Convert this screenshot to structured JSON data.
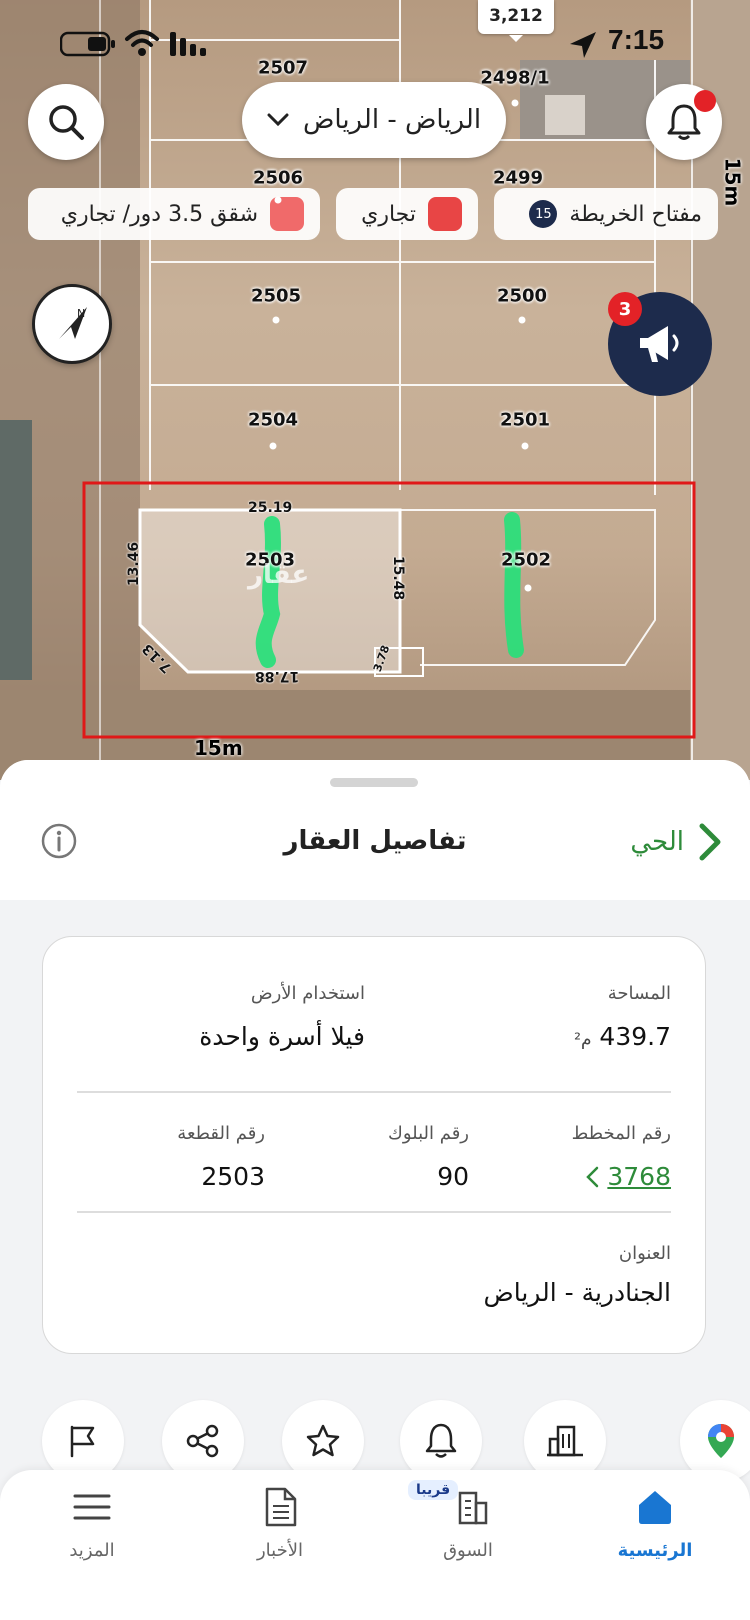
{
  "status_bar": {
    "time": "7:15"
  },
  "map": {
    "count_bubble": "3,212",
    "city": "الرياض - الرياض",
    "streets": {
      "right": "15m",
      "bottom": "15m"
    },
    "legend": [
      {
        "label": "مفتاح الخريطة",
        "badge": "15",
        "color": "#1d2b4c"
      },
      {
        "label": "تجاري",
        "color": "#e84545"
      },
      {
        "label": "شقق 3.5 دور/ تجاري",
        "color": "#f06a6a"
      }
    ],
    "ads_badge": "3",
    "lots": [
      "2507",
      "2498/1",
      "2506",
      "2499",
      "2505",
      "2500",
      "2504",
      "2501",
      "2503",
      "2502"
    ],
    "dimensions": {
      "top": "25.19",
      "left": "13.46",
      "right": "15.48",
      "bottom": "17.88",
      "corner": "7.13",
      "corner2": "3.78"
    },
    "watermark": "عقار"
  },
  "sheet": {
    "title": "تفاصيل العقار",
    "district_link": "الحي",
    "fields": {
      "area_label": "المساحة",
      "area_value": "439.7",
      "area_unit": "م²",
      "land_use_label": "استخدام الأرض",
      "land_use_value": "فيلا أسرة واحدة",
      "plan_label": "رقم المخطط",
      "plan_value": "3768",
      "block_label": "رقم البلوك",
      "block_value": "90",
      "parcel_label": "رقم القطعة",
      "parcel_value": "2503",
      "address_label": "العنوان",
      "address_value": "الجنادرية - الرياض"
    },
    "actions": [
      "map-pin-icon",
      "building-icon",
      "bell-icon",
      "star-icon",
      "share-icon",
      "flag-icon"
    ]
  },
  "tabbar": {
    "tabs": [
      {
        "label": "الرئيسية",
        "icon": "home-icon",
        "active": true
      },
      {
        "label": "السوق",
        "icon": "market-icon"
      },
      {
        "label": "الأخبار",
        "icon": "news-icon"
      },
      {
        "label": "المزيد",
        "icon": "menu-icon"
      }
    ],
    "soon_badge": "قريبا"
  },
  "colors": {
    "accent_green": "#2e8b3a",
    "brand_navy": "#1d2b4c",
    "active_blue": "#1976d2",
    "alert_red": "#e32227"
  }
}
